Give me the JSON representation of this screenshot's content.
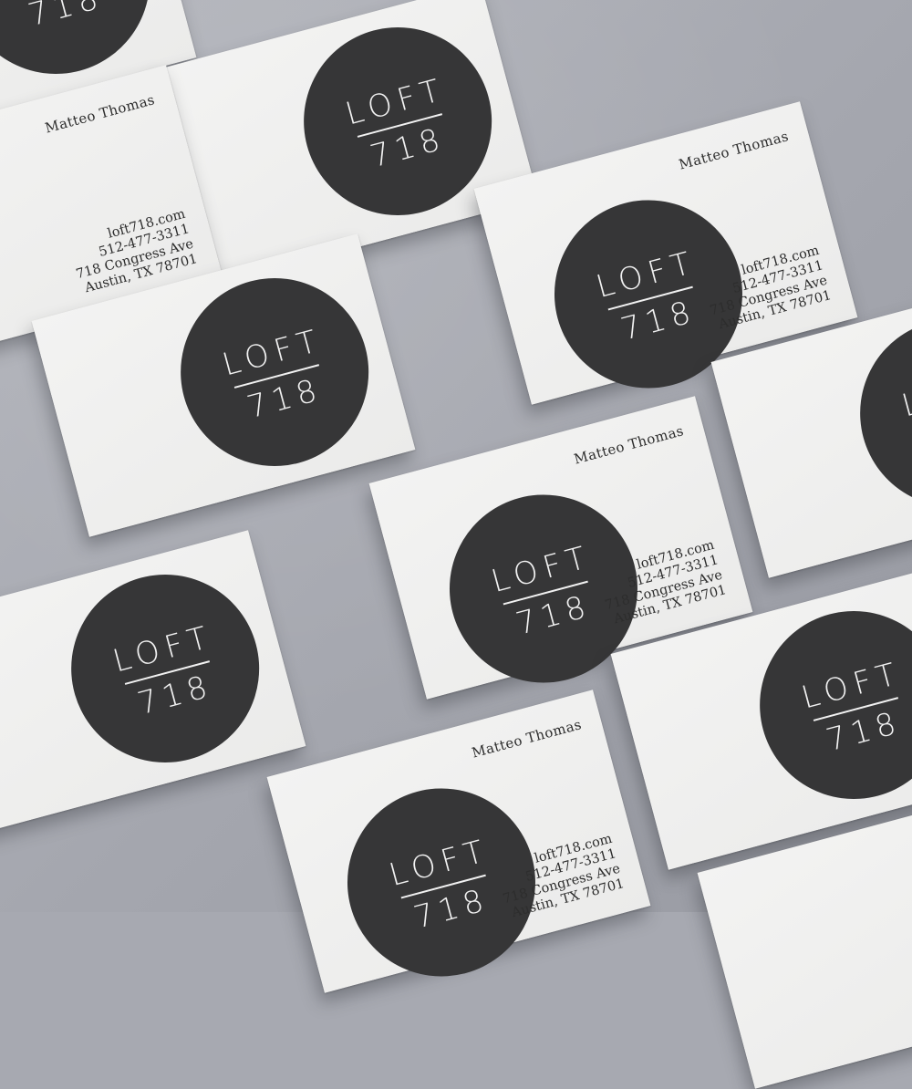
{
  "scene": {
    "background_color": "#a7a9b1",
    "card_color": "#efefee",
    "logo_circle_color": "#363637",
    "logo_text_color": "#f1f1f1"
  },
  "brand": {
    "logo_top": "LOFT",
    "logo_bottom": "718"
  },
  "contact": {
    "name": "Matteo Thomas",
    "website": "loft718.com",
    "phone": "512-477-3311",
    "street": "718 Congress Ave",
    "city": "Austin, TX 78701"
  }
}
